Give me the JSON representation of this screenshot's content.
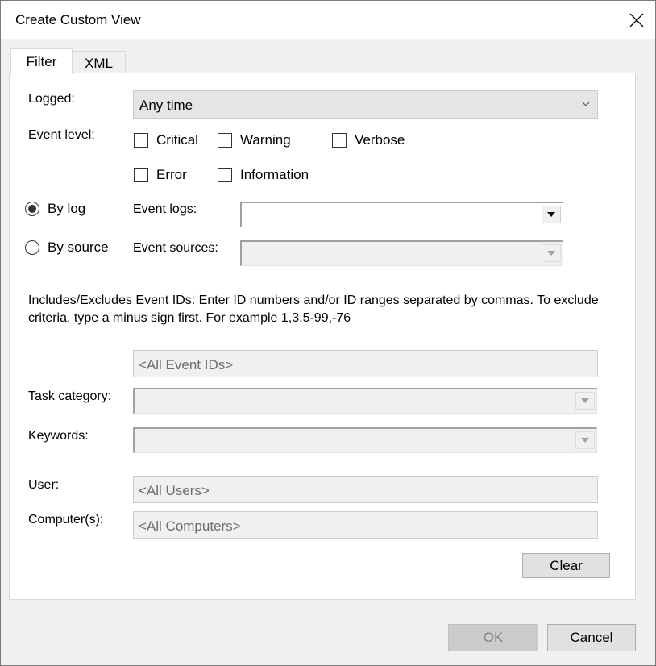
{
  "window": {
    "title": "Create Custom View"
  },
  "tabs": [
    {
      "label": "Filter",
      "active": true
    },
    {
      "label": "XML",
      "active": false
    }
  ],
  "filter": {
    "logged": {
      "label": "Logged:",
      "value": "Any time"
    },
    "event_level": {
      "label": "Event level:",
      "options": [
        {
          "label": "Critical",
          "checked": false
        },
        {
          "label": "Warning",
          "checked": false
        },
        {
          "label": "Verbose",
          "checked": false
        },
        {
          "label": "Error",
          "checked": false
        },
        {
          "label": "Information",
          "checked": false
        }
      ]
    },
    "by_log": {
      "label": "By log",
      "selected": true
    },
    "by_source": {
      "label": "By source",
      "selected": false
    },
    "event_logs": {
      "label": "Event logs:",
      "value": ""
    },
    "event_sources": {
      "label": "Event sources:",
      "value": ""
    },
    "event_ids": {
      "description": "Includes/Excludes Event IDs: Enter ID numbers and/or ID ranges separated by commas. To exclude criteria, type a minus sign first. For example 1,3,5-99,-76",
      "placeholder": "<All Event IDs>"
    },
    "task_category": {
      "label": "Task category:",
      "value": ""
    },
    "keywords": {
      "label": "Keywords:",
      "value": ""
    },
    "user": {
      "label": "User:",
      "placeholder": "<All Users>"
    },
    "computers": {
      "label": "Computer(s):",
      "placeholder": "<All Computers>"
    },
    "clear_label": "Clear"
  },
  "footer": {
    "ok_label": "OK",
    "cancel_label": "Cancel"
  }
}
